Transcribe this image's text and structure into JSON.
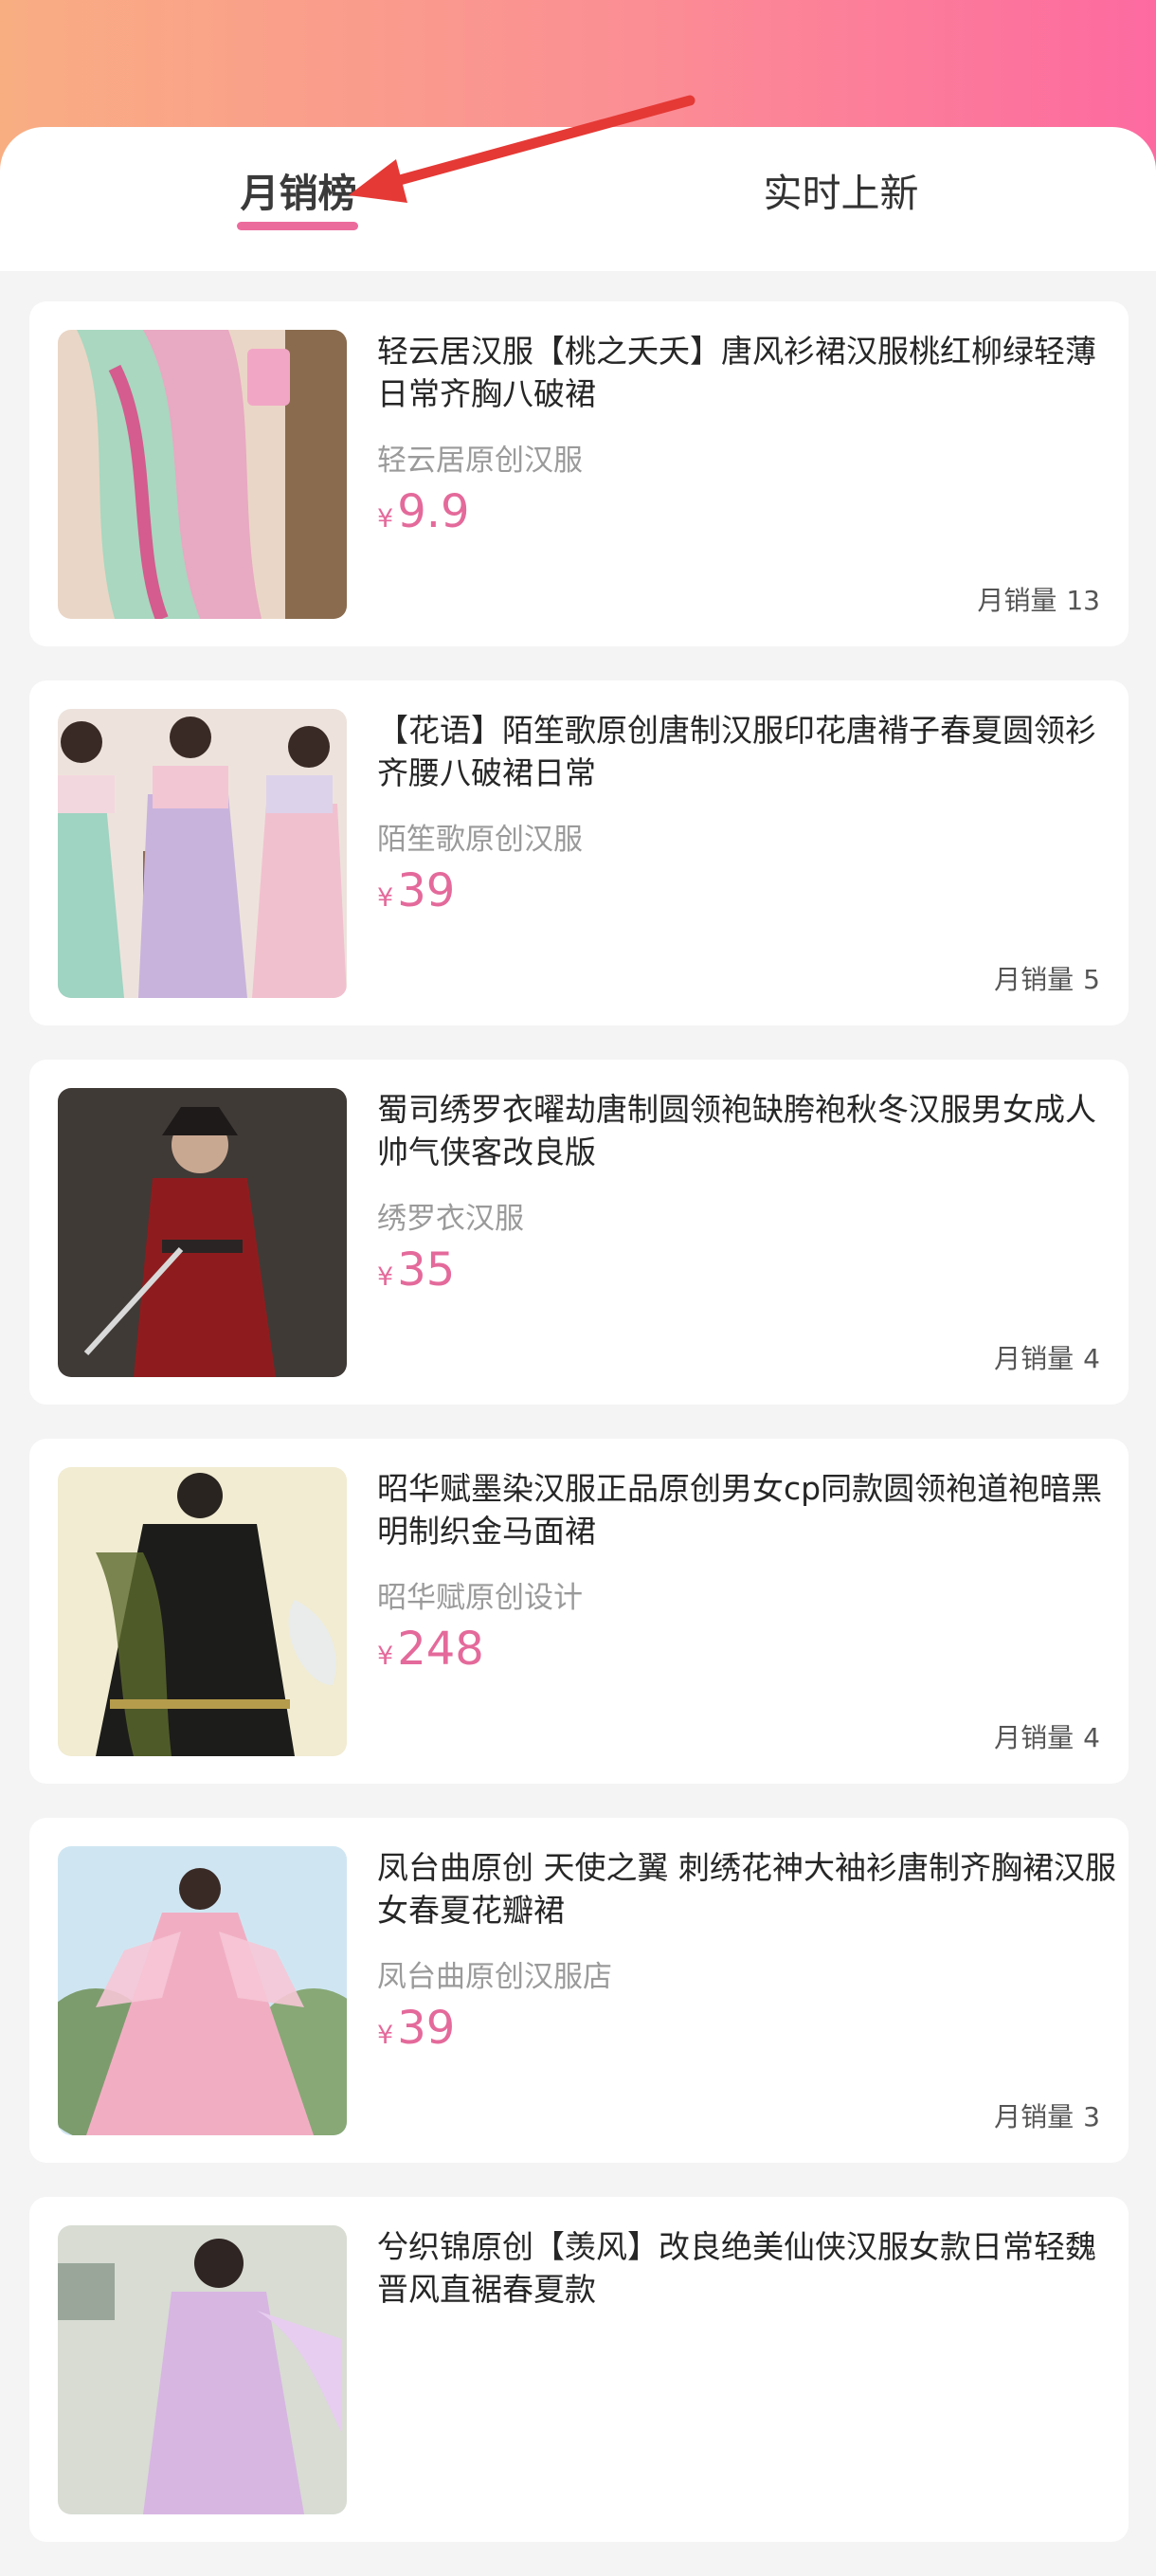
{
  "tabs": [
    {
      "label": "月销榜",
      "active": true
    },
    {
      "label": "实时上新",
      "active": false
    }
  ],
  "colors": {
    "accent": "#e46a9b",
    "underline": "#ec6b9d",
    "annotation_arrow": "#e53935",
    "header_gradient": [
      "#f9ae82",
      "#fd6aa0"
    ]
  },
  "products": [
    {
      "title": "轻云居汉服【桃之夭夭】唐风衫裙汉服桃红柳绿轻薄日常齐胸八破裙",
      "shop": "轻云居原创汉服",
      "currency": "¥",
      "price": "9.9",
      "sales_label": "月销量",
      "sales_value": "13",
      "image_icon": "product-photo-icon"
    },
    {
      "title": "【花语】陌笙歌原创唐制汉服印花唐褙子春夏圆领衫齐腰八破裙日常",
      "shop": "陌笙歌原创汉服",
      "currency": "¥",
      "price": "39",
      "sales_label": "月销量",
      "sales_value": "5",
      "image_icon": "product-photo-icon"
    },
    {
      "title": "蜀司绣罗衣曜劫唐制圆领袍缺胯袍秋冬汉服男女成人帅气侠客改良版",
      "shop": "绣罗衣汉服",
      "currency": "¥",
      "price": "35",
      "sales_label": "月销量",
      "sales_value": "4",
      "image_icon": "product-photo-icon"
    },
    {
      "title": "昭华赋墨染汉服正品原创男女cp同款圆领袍道袍暗黑明制织金马面裙",
      "shop": "昭华赋原创设计",
      "currency": "¥",
      "price": "248",
      "sales_label": "月销量",
      "sales_value": "4",
      "image_icon": "product-photo-icon"
    },
    {
      "title": "凤台曲原创 天使之翼 刺绣花神大袖衫唐制齐胸裙汉服女春夏花瓣裙",
      "shop": "凤台曲原创汉服店",
      "currency": "¥",
      "price": "39",
      "sales_label": "月销量",
      "sales_value": "3",
      "image_icon": "product-photo-icon"
    },
    {
      "title": "兮织锦原创【羡风】改良绝美仙侠汉服女款日常轻魏晋风直裾春夏款",
      "image_icon": "product-photo-icon"
    }
  ]
}
